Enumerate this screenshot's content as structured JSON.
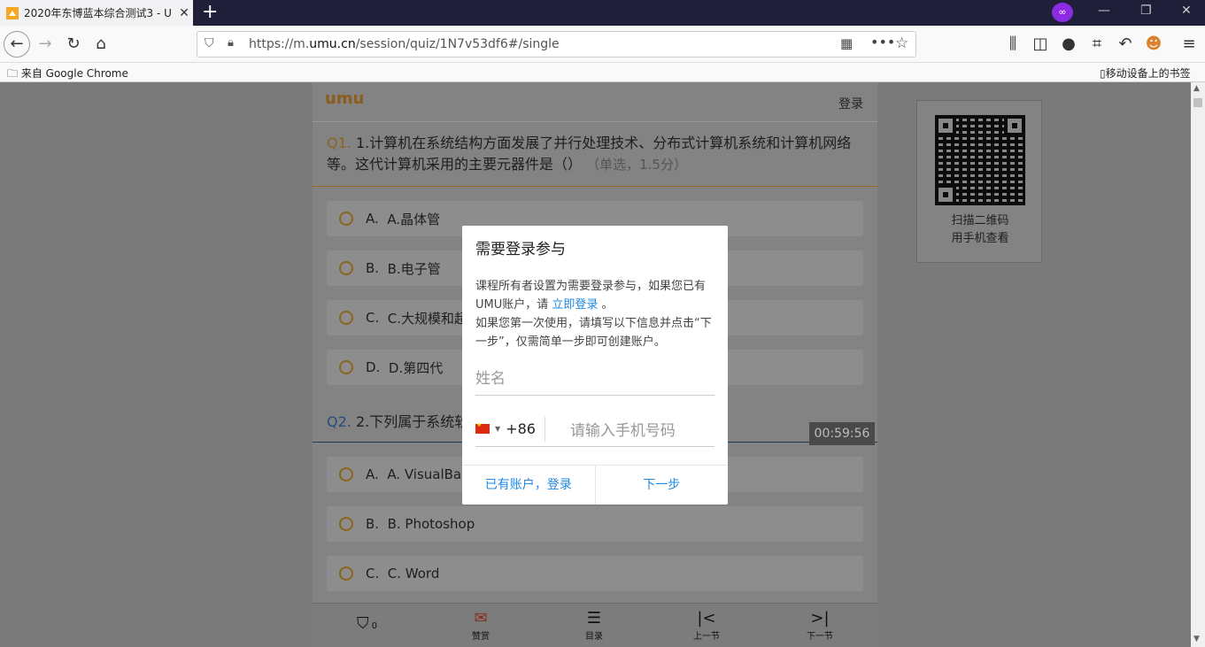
{
  "browser": {
    "tab_title": "2020年东博蓝本综合测试3 - U",
    "tab_close": "✕",
    "new_tab": "+",
    "url_prefix": "https://m.",
    "url_domain": "umu.cn",
    "url_path": "/session/quiz/1N7v53df6#/single",
    "bookmarks_folder": "来自 Google Chrome",
    "mobile_bookmarks": "移动设备上的书签"
  },
  "quiz": {
    "logo": "umu",
    "login_link": "登录",
    "q1": {
      "num": "Q1.",
      "text": "1.计算机在系统结构方面发展了并行处理技术、分布式计算机系统和计算机网络等。这代计算机采用的主要元器件是（）",
      "score": "（单选，1.5分）",
      "options": [
        {
          "letter": "A.",
          "text": "A.晶体管"
        },
        {
          "letter": "B.",
          "text": "B.电子管"
        },
        {
          "letter": "C.",
          "text": "C.大规模和超"
        },
        {
          "letter": "D.",
          "text": "D.第四代"
        }
      ]
    },
    "q2": {
      "num": "Q2.",
      "text": "2.下列属于系统软",
      "options": [
        {
          "letter": "A.",
          "text": " A. VisualBa"
        },
        {
          "letter": "B.",
          "text": "B. Photoshop"
        },
        {
          "letter": "C.",
          "text": "C. Word"
        }
      ]
    },
    "timer": "00:59:56"
  },
  "bottom_bar": {
    "badge_count": "0",
    "like": "赞赏",
    "catalog": "目录",
    "prev": "上一节",
    "next": "下一节"
  },
  "qr": {
    "caption_line1": "扫描二维码",
    "caption_line2": "用手机查看"
  },
  "modal": {
    "title": "需要登录参与",
    "desc1": "课程所有者设置为需要登录参与，如果您已有UMU账户，请 ",
    "desc_link": "立即登录",
    "desc2": " 。",
    "desc3": "如果您第一次使用，请填写以下信息并点击“下一步”，仅需简单一步即可创建账户。",
    "name_placeholder": "姓名",
    "country_code": "+86",
    "phone_placeholder": "请输入手机号码",
    "have_account": "已有账户，登录",
    "next_step": "下一步"
  }
}
